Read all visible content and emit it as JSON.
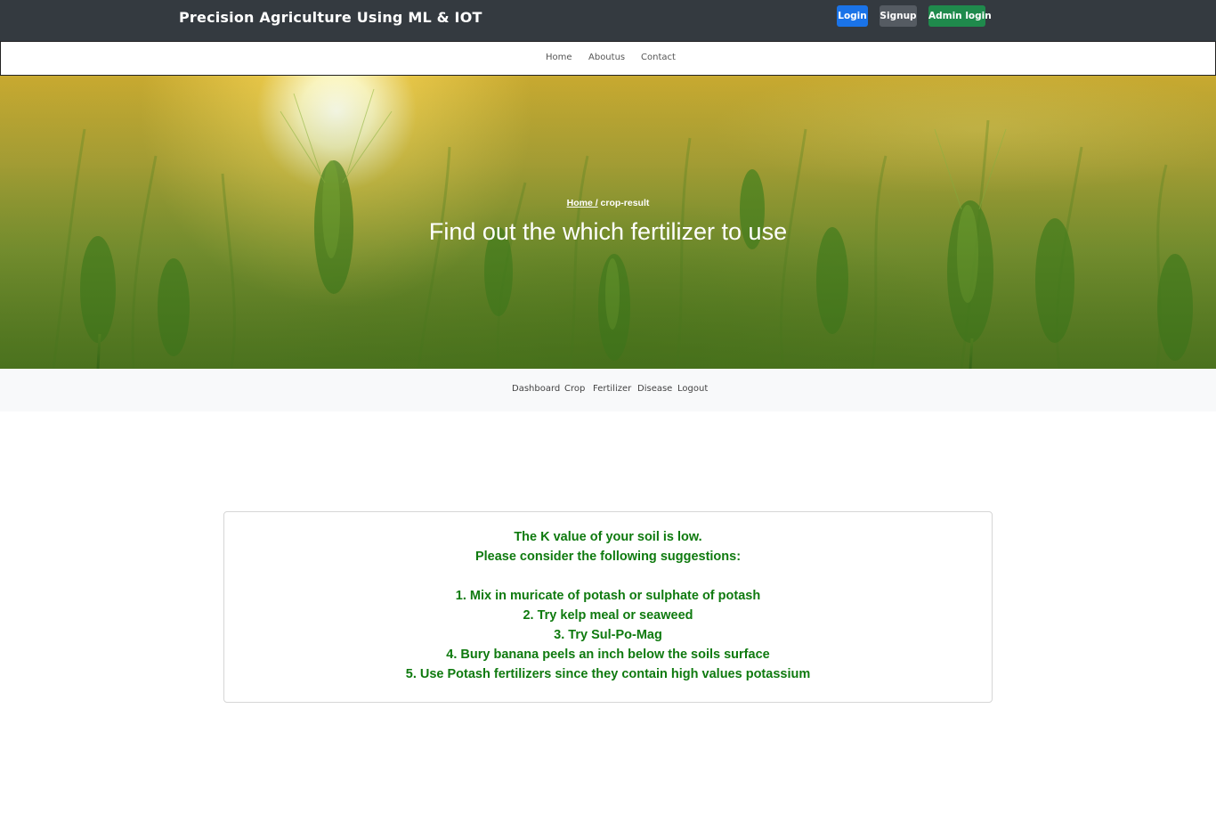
{
  "header": {
    "brand": "Precision Agriculture Using ML & IOT",
    "login_label": "Login",
    "signup_label": "Signup",
    "admin_label": "Admin login"
  },
  "main_nav": {
    "items": [
      "Home",
      "Aboutus",
      "Contact"
    ]
  },
  "hero": {
    "breadcrumb_home": "Home /",
    "breadcrumb_current": "crop-result",
    "title": "Find out the which fertilizer to use"
  },
  "sub_nav": {
    "items": [
      "Dashboard",
      "Crop",
      "Fertilizer",
      "Disease",
      "Logout"
    ]
  },
  "result": {
    "heading": "The K value of your soil is low.",
    "intro": "Please consider the following suggestions:",
    "suggestions": [
      "1. Mix in muricate of potash or sulphate of potash",
      "2. Try kelp meal or seaweed",
      "3. Try Sul-Po-Mag",
      "4. Bury banana peels an inch below the soils surface",
      "5. Use Potash fertilizers since they contain high values potassium"
    ]
  },
  "colors": {
    "header_bg": "#343a40",
    "login_btn": "#1a73e8",
    "signup_btn": "#555b62",
    "admin_btn": "#1f8a4c",
    "result_text": "#0f7a0f",
    "subnav_bg": "#f8f9fa"
  }
}
